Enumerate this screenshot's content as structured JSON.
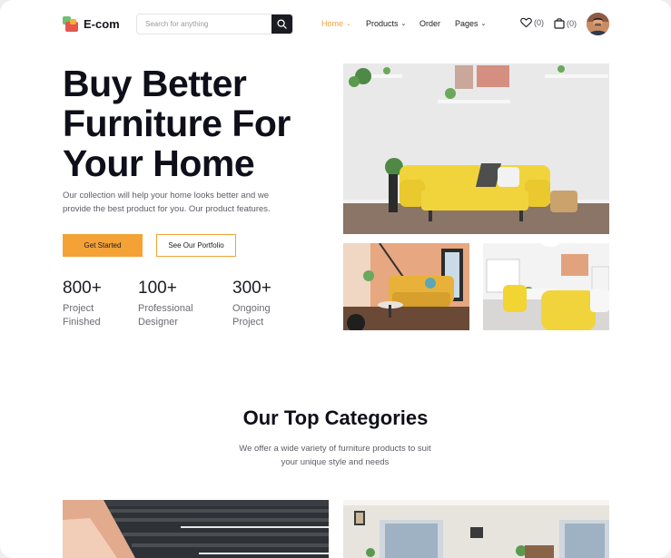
{
  "header": {
    "logo_text": "E-com",
    "search_placeholder": "Search for anything",
    "nav": [
      {
        "label": "Home",
        "active": true,
        "has_dropdown": true
      },
      {
        "label": "Products",
        "active": false,
        "has_dropdown": true
      },
      {
        "label": "Order",
        "active": false,
        "has_dropdown": false
      },
      {
        "label": "Pages",
        "active": false,
        "has_dropdown": true
      }
    ],
    "wishlist_count": "(0)",
    "cart_count": "(0)"
  },
  "hero": {
    "title": "Buy Better Furniture For Your Home",
    "description": "Our collection will help your home looks better and we provide the best product for you. Our product features.",
    "primary_button": "Get Started",
    "secondary_button": "See Our Portfolio",
    "stats": [
      {
        "value": "800+",
        "label": "Project Finished"
      },
      {
        "value": "100+",
        "label": "Professional Designer"
      },
      {
        "value": "300+",
        "label": "Ongoing Project"
      }
    ]
  },
  "categories": {
    "title": "Our Top Categories",
    "description": "We offer a wide variety of furniture products to suit your unique style and needs"
  },
  "colors": {
    "accent": "#f4a236",
    "dark": "#1b1b22",
    "sofa_yellow": "#f1d43c"
  },
  "icons": [
    "search-icon",
    "heart-icon",
    "shopping-bag-icon",
    "chevron-down-icon"
  ]
}
